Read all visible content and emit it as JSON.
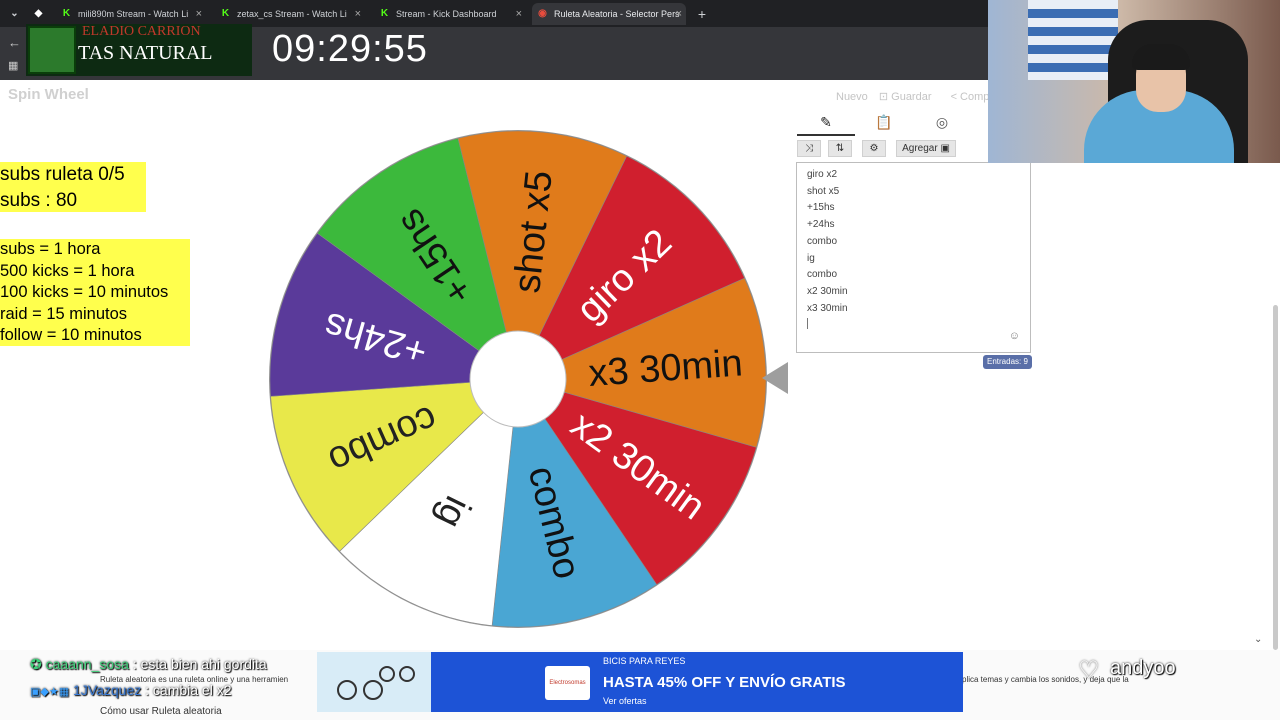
{
  "browser": {
    "tabs": [
      {
        "title": "mili890m Stream - Watch Li",
        "icon": "kick-icon",
        "color": "#53fc18"
      },
      {
        "title": "zetax_cs Stream - Watch Li",
        "icon": "kick-icon",
        "color": "#53fc18"
      },
      {
        "title": "Stream - Kick Dashboard",
        "icon": "kick-icon",
        "color": "#53fc18"
      },
      {
        "title": "Ruleta Aleatoria - Selector Pers",
        "icon": "wheel-favicon",
        "color": "#e84c3d"
      }
    ],
    "new_tab": "+"
  },
  "overlay": {
    "banner_line1": "ELADIO CARRION",
    "banner_line2": "TAS NATURAL",
    "clock": "09:29:55"
  },
  "app": {
    "brand": "Spin Wheel",
    "actions": {
      "new": "Nuevo",
      "save": "Guardar",
      "share": "Compa"
    },
    "info_box1": [
      "subs ruleta 0/5",
      "subs : 80"
    ],
    "info_box2": [
      "subs = 1 hora",
      "500 kicks = 1 hora",
      "100 kicks = 10 minutos",
      "raid = 15 minutos",
      "follow = 10 minutos"
    ],
    "panel": {
      "add_button": "Agregar",
      "entries": [
        "giro x2",
        "shot x5",
        "+15hs",
        "+24hs",
        "combo",
        "ig",
        "combo",
        "x2 30min",
        "x3 30min"
      ],
      "count_label": "Entradas: 9"
    }
  },
  "chart_data": {
    "type": "pie",
    "labels": [
      "x3 30min",
      "x2 30min",
      "combo",
      "ig",
      "combo",
      "+24hs",
      "+15hs",
      "shot x5",
      "giro x2"
    ],
    "values": [
      1,
      1,
      1,
      1,
      1,
      1,
      1,
      1,
      1
    ],
    "colors": [
      "#e07b1b",
      "#d01f2e",
      "#4aa6d3",
      "#ffffff",
      "#e8e84a",
      "#5a3a9a",
      "#3cb93c",
      "#e07b1b",
      "#d01f2e"
    ]
  },
  "chat": {
    "messages": [
      {
        "user": "caaann_sosa",
        "text": ": esta bien ahi gordita"
      },
      {
        "user": "1JVazquez",
        "text": ": cambia el x2"
      }
    ],
    "page_text_left": "Ruleta aleatoria es una ruleta online y una herramien",
    "page_text_left2": "Cómo usar Ruleta aleatoria",
    "page_text_right": "plica temas y cambia los sonidos, y deja que la",
    "streamer": "andyoo"
  },
  "ad": {
    "brand": "Electrosomas",
    "line1": "BICIS PARA REYES",
    "line2": "HASTA 45% OFF Y ENVÍO GRATIS",
    "line3": "Ver ofertas"
  }
}
